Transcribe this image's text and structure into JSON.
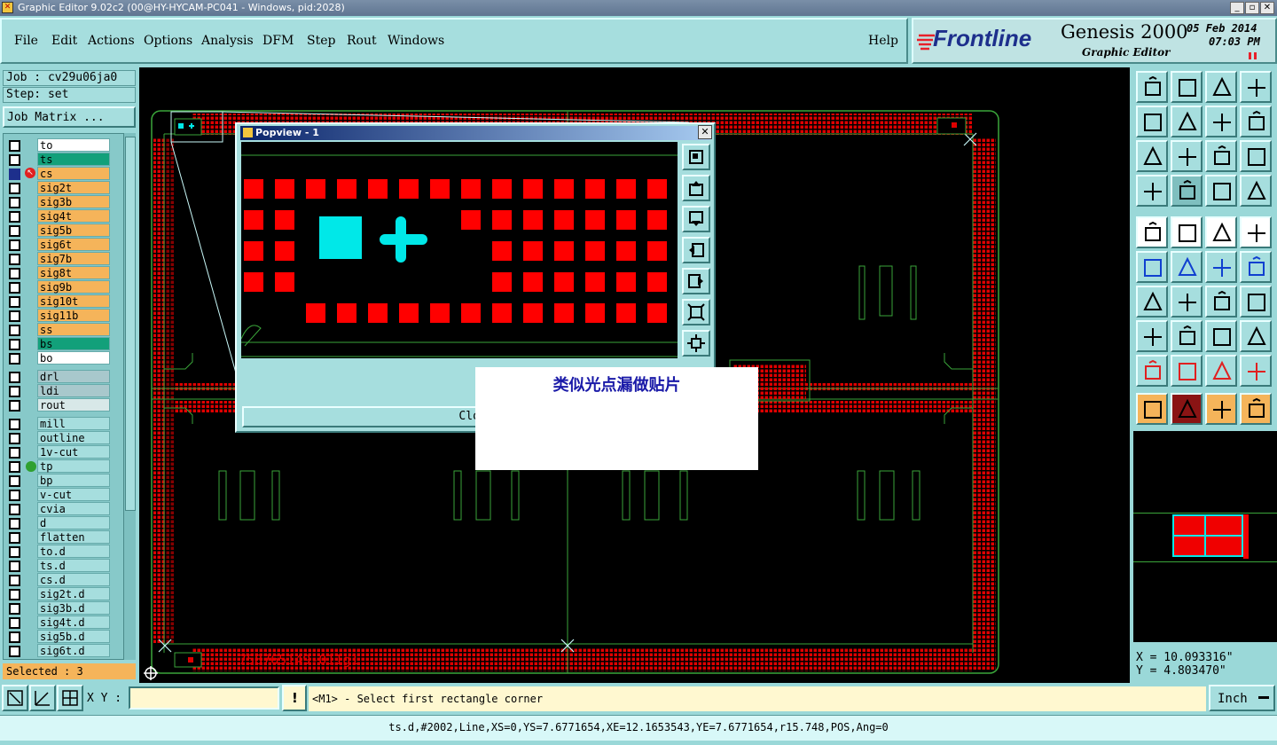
{
  "window": {
    "title": "Graphic Editor 9.02c2 (00@HY-HYCAM-PC041 - Windows, pid:2028)",
    "minimize": "_",
    "restore": "▫",
    "close": "✕"
  },
  "menu": {
    "items": [
      "File",
      "Edit",
      "Actions",
      "Options",
      "Analysis",
      "DFM",
      "Step",
      "Rout",
      "Windows"
    ],
    "help": "Help"
  },
  "brand": {
    "logo": "Frontline",
    "product": "Genesis 2000",
    "subtitle": "Graphic Editor",
    "date": "05 Feb 2014",
    "time": "07:03 PM",
    "accent": "#e8202a"
  },
  "job": {
    "job_label": "Job : cv29u06ja0",
    "step_label": "Step: set",
    "matrix_button": "Job Matrix ..."
  },
  "layers": {
    "group1": [
      {
        "name": "to",
        "color": "#ffffff",
        "marker": ""
      },
      {
        "name": "ts",
        "color": "#12a07a",
        "marker": ""
      },
      {
        "name": "cs",
        "color": "#f5b45a",
        "marker": "edit"
      },
      {
        "name": "sig2t",
        "color": "#f5b45a",
        "marker": ""
      },
      {
        "name": "sig3b",
        "color": "#f5b45a",
        "marker": ""
      },
      {
        "name": "sig4t",
        "color": "#f5b45a",
        "marker": ""
      },
      {
        "name": "sig5b",
        "color": "#f5b45a",
        "marker": ""
      },
      {
        "name": "sig6t",
        "color": "#f5b45a",
        "marker": ""
      },
      {
        "name": "sig7b",
        "color": "#f5b45a",
        "marker": ""
      },
      {
        "name": "sig8t",
        "color": "#f5b45a",
        "marker": ""
      },
      {
        "name": "sig9b",
        "color": "#f5b45a",
        "marker": ""
      },
      {
        "name": "sig10t",
        "color": "#f5b45a",
        "marker": ""
      },
      {
        "name": "sig11b",
        "color": "#f5b45a",
        "marker": ""
      },
      {
        "name": "ss",
        "color": "#f5b45a",
        "marker": ""
      },
      {
        "name": "bs",
        "color": "#12a07a",
        "marker": ""
      },
      {
        "name": "bo",
        "color": "#ffffff",
        "marker": ""
      }
    ],
    "group2": [
      {
        "name": "drl",
        "color": "#a8c8cc",
        "marker": ""
      },
      {
        "name": "ldi",
        "color": "#a8c8cc",
        "marker": ""
      },
      {
        "name": "rout",
        "color": "#d8e8e8",
        "marker": ""
      }
    ],
    "group3": [
      {
        "name": "mill",
        "color": "#a6dede",
        "marker": ""
      },
      {
        "name": "outline",
        "color": "#a6dede",
        "marker": ""
      },
      {
        "name": "1v-cut",
        "color": "#a6dede",
        "marker": ""
      },
      {
        "name": "tp",
        "color": "#a6dede",
        "marker": "work"
      },
      {
        "name": "bp",
        "color": "#a6dede",
        "marker": ""
      },
      {
        "name": "v-cut",
        "color": "#a6dede",
        "marker": ""
      },
      {
        "name": "cvia",
        "color": "#a6dede",
        "marker": ""
      },
      {
        "name": "d",
        "color": "#a6dede",
        "marker": ""
      },
      {
        "name": "flatten",
        "color": "#a6dede",
        "marker": ""
      },
      {
        "name": "to.d",
        "color": "#a6dede",
        "marker": ""
      },
      {
        "name": "ts.d",
        "color": "#a6dede",
        "marker": ""
      },
      {
        "name": "cs.d",
        "color": "#a6dede",
        "marker": ""
      },
      {
        "name": "sig2t.d",
        "color": "#a6dede",
        "marker": ""
      },
      {
        "name": "sig3b.d",
        "color": "#a6dede",
        "marker": ""
      },
      {
        "name": "sig4t.d",
        "color": "#a6dede",
        "marker": ""
      },
      {
        "name": "sig5b.d",
        "color": "#a6dede",
        "marker": ""
      },
      {
        "name": "sig6t.d",
        "color": "#a6dede",
        "marker": ""
      }
    ],
    "selected": "Selected : 3"
  },
  "canvas": {
    "board_label": "758765149-011g1",
    "trace_color": "#3aa53a",
    "pad_color": "#e00000"
  },
  "popview": {
    "title": "Popview - 1",
    "close_button": "Close",
    "pad_color": "#ff0000",
    "feature_color": "#00e8e8"
  },
  "annotation": {
    "text": "类似光点漏做贴片"
  },
  "bottom": {
    "xy_label": "X Y :",
    "xy_value": "",
    "prompt": "<M1> - Select first rectangle corner",
    "units": "Inch",
    "coord_x": "X = 10.093316\"",
    "coord_y": "Y = 4.803470\"",
    "feature_info": "ts.d,#2002,Line,XS=0,YS=7.6771654,XE=12.1653543,YE=7.6771654,r15.748,POS,Ang=0"
  }
}
